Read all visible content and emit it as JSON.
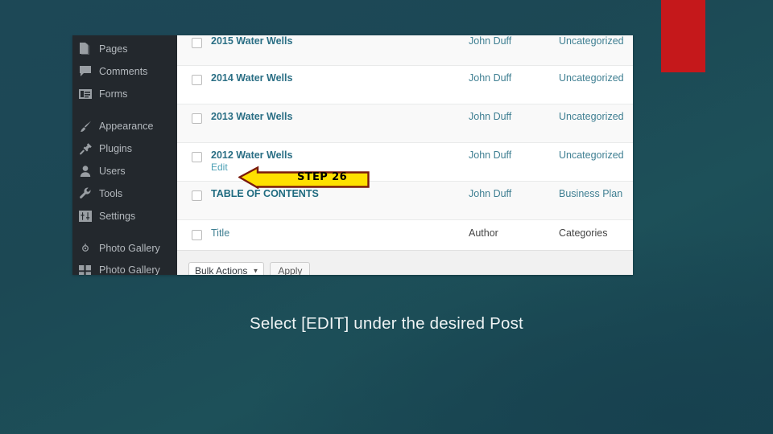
{
  "colors": {
    "background_teal": "#1c4854",
    "red_block": "#c5181b",
    "sidebar_dark": "#23282d",
    "link_teal": "#2b6f85",
    "callout_fill": "#ffe000",
    "callout_border": "#7a1a0d"
  },
  "sidebar": {
    "items": [
      {
        "label": "Pages",
        "icon": "pages-icon"
      },
      {
        "label": "Comments",
        "icon": "comment-bubble-icon"
      },
      {
        "label": "Forms",
        "icon": "form-icon"
      },
      {
        "label": "Appearance",
        "icon": "paintbrush-icon"
      },
      {
        "label": "Plugins",
        "icon": "plug-icon"
      },
      {
        "label": "Users",
        "icon": "user-icon"
      },
      {
        "label": "Tools",
        "icon": "wrench-icon"
      },
      {
        "label": "Settings",
        "icon": "sliders-icon"
      },
      {
        "label": "Photo Gallery",
        "icon": "camera-dot-icon"
      },
      {
        "label": "Photo Gallery Add-ons",
        "icon": "gallery-addons-icon"
      }
    ]
  },
  "posts_table": {
    "columns": [
      "Title",
      "Author",
      "Categories"
    ],
    "rows": [
      {
        "title": "2015 Water Wells",
        "author": "John Duff",
        "category": "Uncategorized",
        "action": ""
      },
      {
        "title": "2014 Water Wells",
        "author": "John Duff",
        "category": "Uncategorized",
        "action": ""
      },
      {
        "title": "2013 Water Wells",
        "author": "John Duff",
        "category": "Uncategorized",
        "action": ""
      },
      {
        "title": "2012 Water Wells",
        "author": "John Duff",
        "category": "Uncategorized",
        "action": "Edit"
      },
      {
        "title": "TABLE OF CONTENTS",
        "author": "John Duff",
        "category": "Business Plan",
        "action": ""
      }
    ],
    "footer_header": {
      "title": "Title",
      "author": "Author",
      "category": "Categories"
    }
  },
  "bulk_bar": {
    "select_value": "Bulk Actions",
    "apply_label": "Apply"
  },
  "callout": {
    "step_label": "STEP 26"
  },
  "caption": {
    "text": "Select [EDIT] under the desired Post"
  }
}
